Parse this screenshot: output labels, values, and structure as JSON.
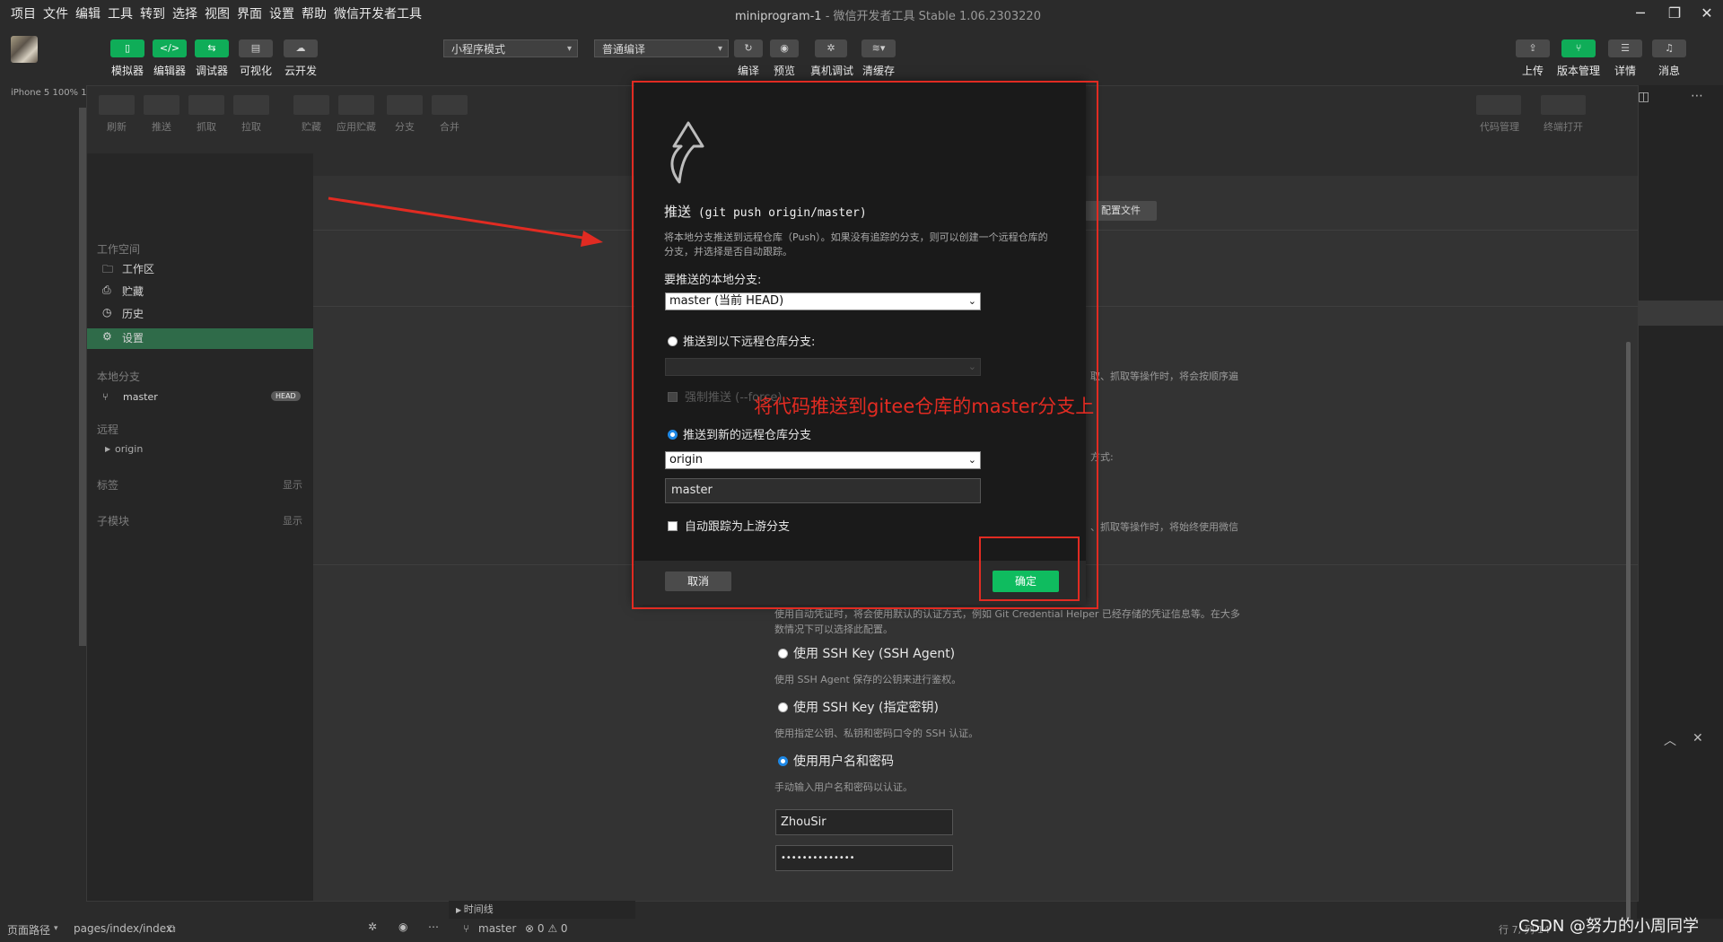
{
  "menubar": {
    "items": [
      "项目",
      "文件",
      "编辑",
      "工具",
      "转到",
      "选择",
      "视图",
      "界面",
      "设置",
      "帮助",
      "微信开发者工具"
    ],
    "title": "miniprogram-1",
    "title_sub": " - 微信开发者工具 Stable 1.06.2303220"
  },
  "toolbar": {
    "left_buttons": [
      "模拟器",
      "编辑器",
      "调试器",
      "可视化",
      "云开发"
    ],
    "mode_select": "小程序模式",
    "compile_select": "普通编译",
    "center_buttons": [
      "编译",
      "预览",
      "真机调试",
      "清缓存"
    ],
    "right_buttons": [
      "上传",
      "版本管理",
      "详情",
      "消息"
    ]
  },
  "simulator": {
    "device_label": "iPhone 5 100% 16"
  },
  "git": {
    "toolbar": [
      "刷新",
      "推送",
      "抓取",
      "拉取",
      "贮藏",
      "应用贮藏",
      "分支",
      "合并"
    ],
    "toolbar_right": [
      "代码管理",
      "终端打开"
    ],
    "sidebar": {
      "workspace_header": "工作空间",
      "workspace_items": [
        "工作区",
        "贮藏",
        "历史",
        "设置"
      ],
      "local_branch_header": "本地分支",
      "branch": "master",
      "branch_badge": "HEAD",
      "remote_header": "远程",
      "remote": "origin",
      "tags_header": "标签",
      "tags_action": "显示",
      "submodule_header": "子模块",
      "submodule_action": "显示"
    },
    "main": {
      "config_button": "配置文件",
      "text_1": "取、抓取等操作时，将会按顺序遍",
      "text_2": "方式:",
      "text_3": "、抓取等操作时，将始终使用微信",
      "auto_desc_1": "使用自动凭证时，将会使用默认的认证方式，例如 Git Credential Helper 已经存储的凭证信息等。在大多",
      "auto_desc_2": "数情况下可以选择此配置。",
      "opt_ssh_agent": "使用 SSH Key (SSH Agent)",
      "opt_ssh_agent_desc": "使用 SSH Agent 保存的公钥来进行鉴权。",
      "opt_ssh_key": "使用 SSH Key (指定密钥)",
      "opt_ssh_key_desc": "使用指定公钥、私钥和密码口令的 SSH 认证。",
      "opt_userpass": "使用用户名和密码",
      "opt_userpass_desc": "手动输入用户名和密码以认证。",
      "username": "ZhouSir",
      "password": "••••••••••••••"
    }
  },
  "dialog": {
    "title": "推送",
    "title_cmd": " (git push origin/master)",
    "description": "将本地分支推送到远程仓库（Push）。如果没有追踪的分支，则可以创建一个远程仓库的分支，并选择是否自动跟踪。",
    "local_branch_label": "要推送的本地分支:",
    "local_branch_value": "master (当前 HEAD)",
    "opt_existing": "推送到以下远程仓库分支:",
    "force_push": "强制推送 (--force)",
    "opt_new": "推送到新的远程仓库分支",
    "remote_value": "origin",
    "new_branch_value": "master",
    "auto_track": "自动跟踪为上游分支",
    "cancel": "取消",
    "ok": "确定"
  },
  "annotation": {
    "text": "将代码推送到gitee仓库的master分支上"
  },
  "statusbar": {
    "page_path_label": "页面路径",
    "page_path": "pages/index/index",
    "timeline": "时间线",
    "branch": "master",
    "problems": "⊗ 0 ⚠ 0",
    "cursor": "行 7, 列 14"
  },
  "watermark": "CSDN @努力的小周同学",
  "colors": {
    "accent_green": "#0fbc5f",
    "annotation_red": "#e12b22",
    "selected_row": "#2f6b49"
  }
}
